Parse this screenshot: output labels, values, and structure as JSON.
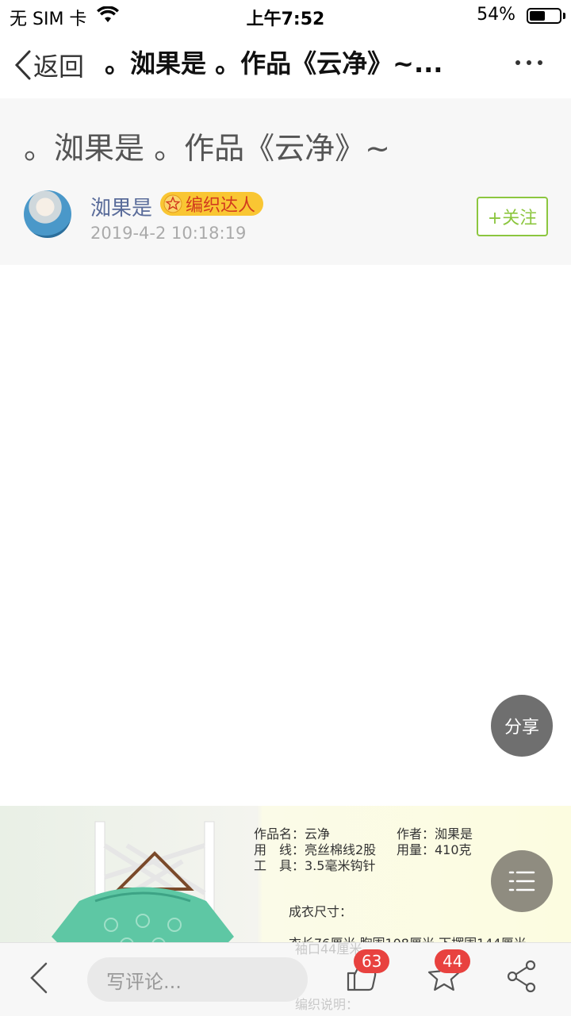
{
  "status_bar": {
    "carrier": "无 SIM 卡",
    "time": "上午7:52",
    "battery_pct": "54%",
    "battery_level": 0.54
  },
  "nav": {
    "back_label": "返回",
    "title": "。洳果是 。作品《云净》~...",
    "more_icon": "more-dots-icon"
  },
  "post": {
    "title": "。洳果是 。作品《云净》~",
    "author": "洳果是",
    "badge": "编织达人",
    "date": "2019-4-2 10:18:19",
    "follow_label": "+关注"
  },
  "floating": {
    "share_label": "分享",
    "toc_icon": "list-icon"
  },
  "article_image": {
    "lines": [
      {
        "left": "作品名：云净",
        "right": "作者：洳果是"
      },
      {
        "left": "用　线：亮丝棉线2股",
        "right": "用量：410克"
      },
      {
        "left": "工　具：3.5毫米钩针",
        "right": ""
      }
    ],
    "section": "成衣尺寸：",
    "size_line": "衣长76厘米  胸围108厘米  下摆围144厘米",
    "size_line2": "袖口44厘米",
    "note": "编织说明："
  },
  "bottom_bar": {
    "comment_placeholder": "写评论...",
    "like_count": "63",
    "fav_count": "44"
  },
  "colors": {
    "accent_green": "#8cc63f",
    "badge_yellow": "#f9c633",
    "count_red": "#e8423f",
    "author_blue": "#5a6c9a"
  }
}
